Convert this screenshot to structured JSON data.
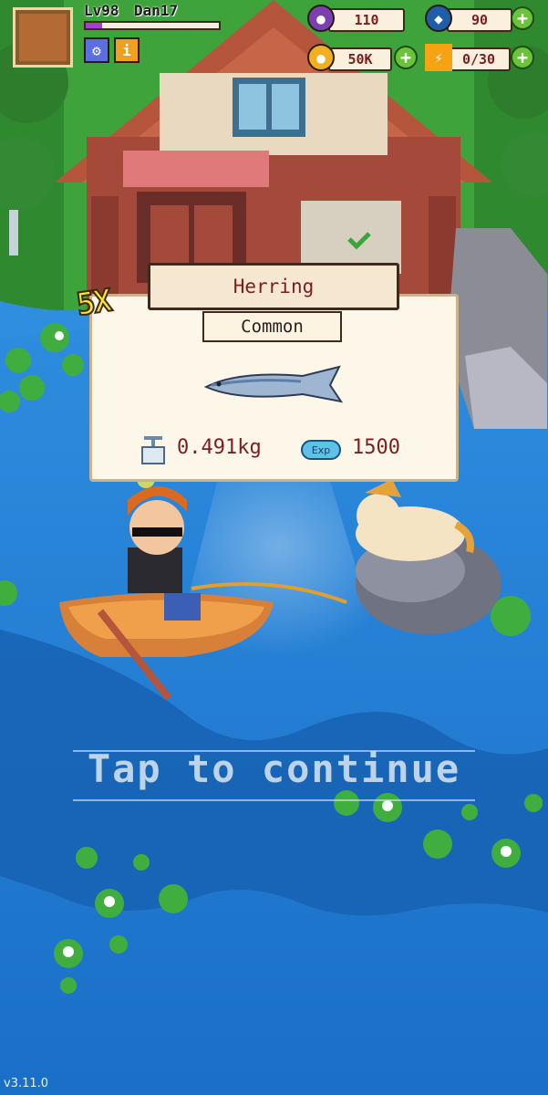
{
  "player": {
    "level": "Lv98",
    "name": "Dan17",
    "xp_fraction": 0.12
  },
  "hud_buttons": [
    {
      "icon": "gear-icon",
      "symbol": "⚙"
    },
    {
      "icon": "info-icon",
      "symbol": "i"
    }
  ],
  "resources": [
    {
      "id": "purple-currency",
      "value": "110",
      "icon": "purple-orb-icon",
      "color": "#7b3fb1"
    },
    {
      "id": "fish-currency",
      "value": "90",
      "icon": "fish-token-icon",
      "color": "#1f5da8"
    },
    {
      "id": "coins",
      "value": "50K",
      "icon": "coin-icon",
      "color": "#f0b020"
    },
    {
      "id": "energy",
      "value": "0/30",
      "icon": "lightning-icon",
      "color": "#f5a313"
    }
  ],
  "catch": {
    "fish_name": "Herring",
    "rarity": "Common",
    "multiplier": "5X",
    "weight": "0.491kg",
    "exp_label": "Exp",
    "exp_value": "1500"
  },
  "prompt": "Tap to continue",
  "version": "v3.11.0",
  "colors": {
    "water": "#1e7fd6",
    "grass": "#3ea33a",
    "popup_bg": "#fdf7ea",
    "text_red": "#7a1f1f"
  }
}
